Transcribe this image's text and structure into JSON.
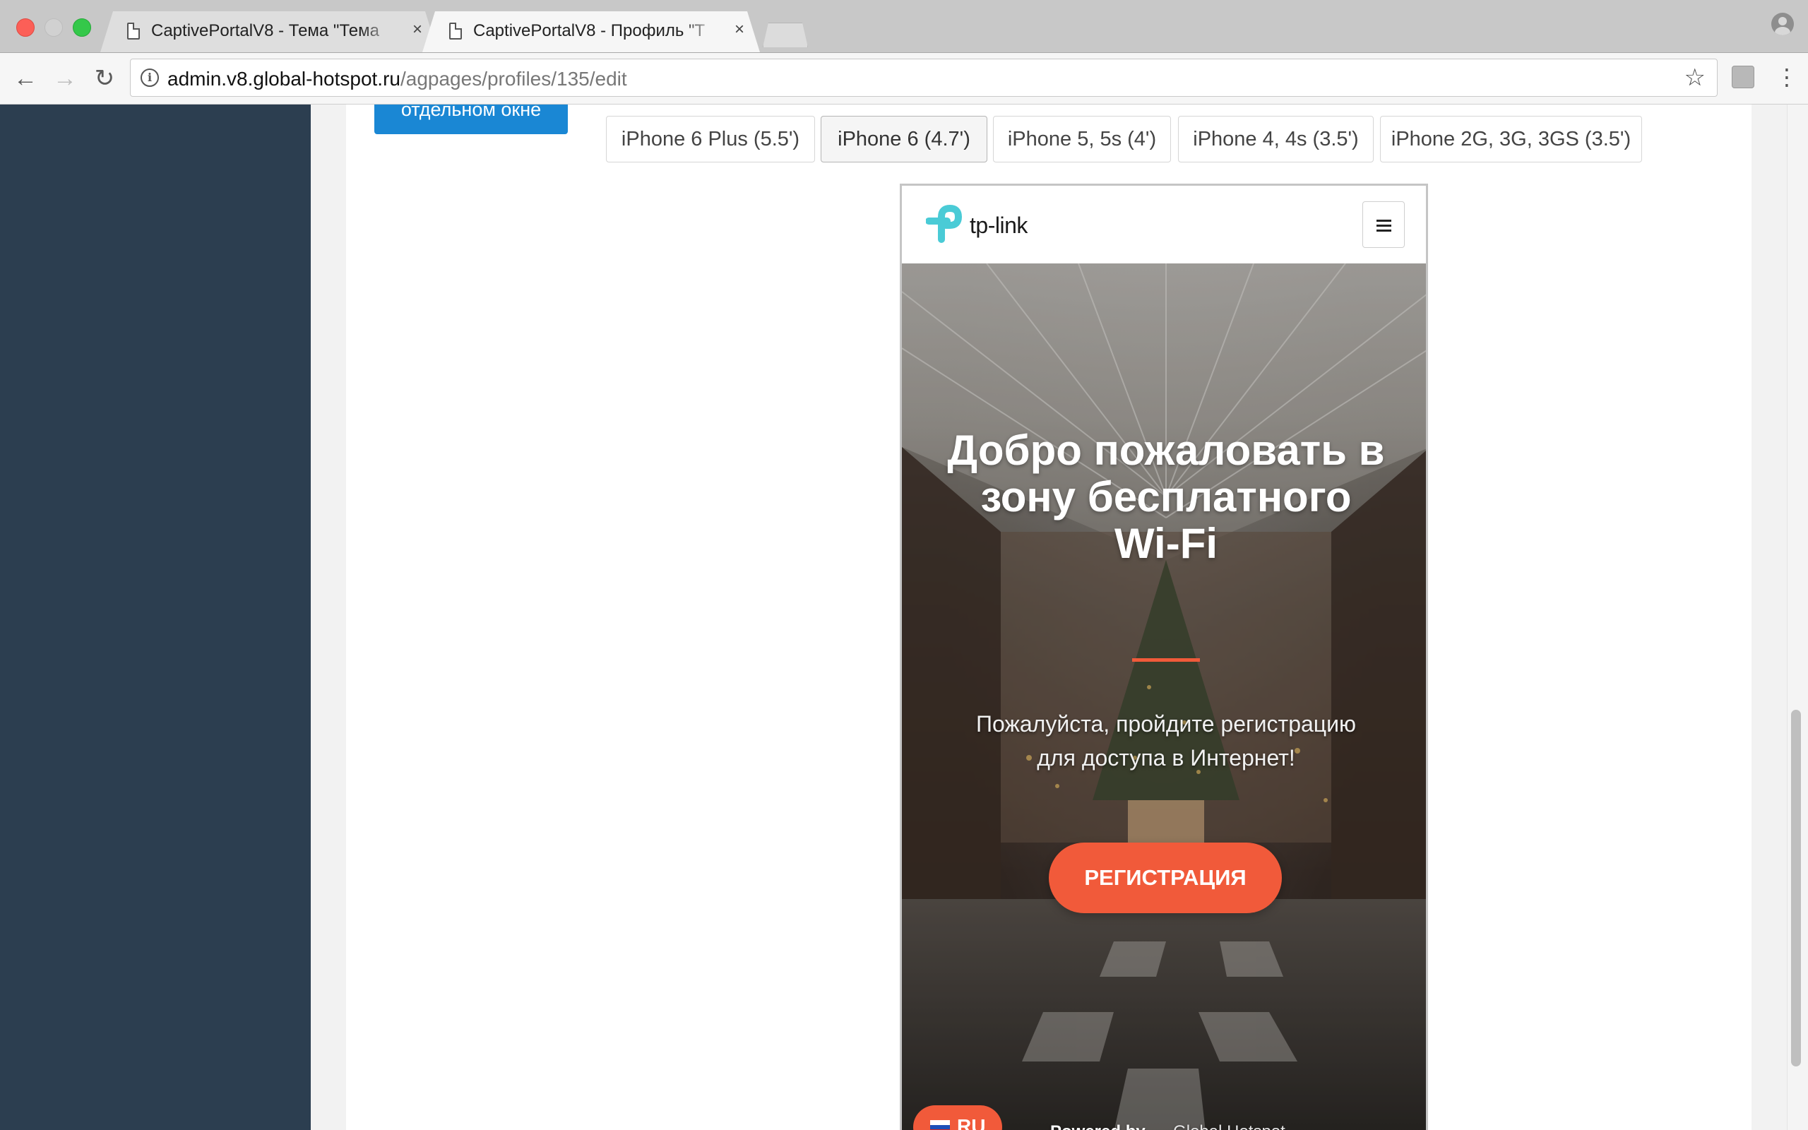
{
  "browser": {
    "tabs": [
      {
        "title": "CaptivePortalV8 - Тема \"Тема",
        "close": "×",
        "active": false
      },
      {
        "title": "CaptivePortalV8 - Профиль \"Т",
        "close": "×",
        "active": true
      }
    ],
    "url_host": "admin.v8.global-hotspot.ru",
    "url_path": "/agpages/profiles/135/edit",
    "icons": [
      "back-icon",
      "forward-icon",
      "reload-icon",
      "info-icon",
      "star-icon",
      "extension-icon",
      "menu-icon",
      "profile-icon",
      "page-icon"
    ]
  },
  "toolbar": {
    "open_window_label": "отдельном окне"
  },
  "devices": [
    {
      "label": "iPhone 6 Plus (5.5')",
      "active": false
    },
    {
      "label": "iPhone 6 (4.7')",
      "active": true
    },
    {
      "label": "iPhone 5, 5s (4')",
      "active": false
    },
    {
      "label": "iPhone 4, 4s (3.5')",
      "active": false
    },
    {
      "label": "iPhone 2G, 3G, 3GS (3.5')",
      "active": false
    }
  ],
  "preview": {
    "brand": "tp-link",
    "title": "Добро пожаловать в зону бесплатного Wi-Fi",
    "subtitle": "Пожалуйста, пройдите регистрацию для доступа в Интернет!",
    "register_label": "РЕГИСТРАЦИЯ",
    "language": "RU",
    "powered_by": "Powered by",
    "powered_brand": "Global Hotspot"
  },
  "colors": {
    "sidebar": "#2c3e50",
    "primary_button": "#1a87d4",
    "accent": "#f15a3a",
    "tplink_brand": "#4acbd6"
  }
}
